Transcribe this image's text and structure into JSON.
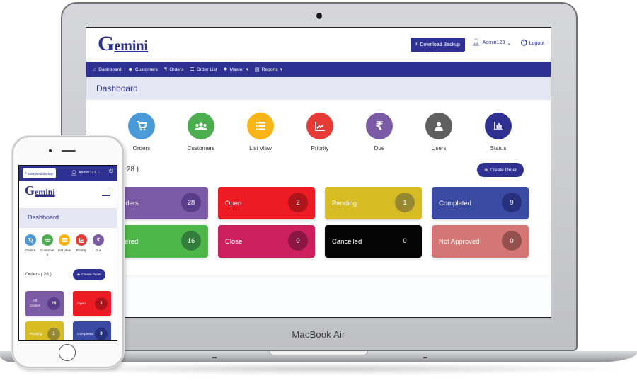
{
  "device": {
    "laptop_label": "MacBook Air"
  },
  "app": {
    "logo_initial": "G",
    "logo_rest": "emini",
    "download_backup_label": "Download Backup",
    "username": "Admin123",
    "logout_label": "Logout",
    "brand_color": "#2e3192"
  },
  "nav": {
    "items": [
      {
        "label": "Dashboard",
        "icon": "dashboard-icon",
        "glyph": "⌂",
        "dropdown": false
      },
      {
        "label": "Customers",
        "icon": "customers-icon",
        "glyph": "☻",
        "dropdown": false
      },
      {
        "label": "Orders",
        "icon": "rupee-icon",
        "glyph": "₹",
        "dropdown": false
      },
      {
        "label": "Order List",
        "icon": "list-icon",
        "glyph": "☰",
        "dropdown": false
      },
      {
        "label": "Master",
        "icon": "gear-icon",
        "glyph": "✹",
        "dropdown": true
      },
      {
        "label": "Reports",
        "icon": "document-icon",
        "glyph": "▤",
        "dropdown": true
      }
    ]
  },
  "page": {
    "title": "Dashboard",
    "orders_heading": "Orders ( 28 )",
    "orders_heading_laptop_visible": "ers ( 28 )",
    "create_order_label": "Create Order"
  },
  "quick_links": [
    {
      "label": "Orders",
      "icon": "cart-icon",
      "glyph": "🛒",
      "color": "#4a9ad8"
    },
    {
      "label": "Customers",
      "icon": "customers-icon",
      "glyph": "👥",
      "color": "#4cae4f"
    },
    {
      "label": "List View",
      "icon": "list-icon",
      "glyph": "☰",
      "color": "#fbb416"
    },
    {
      "label": "Priority",
      "icon": "chart-icon",
      "glyph": "📈",
      "color": "#e53a35"
    },
    {
      "label": "Due",
      "icon": "rupee-icon",
      "glyph": "₹",
      "color": "#7b5aa6"
    },
    {
      "label": "Users",
      "icon": "user-icon",
      "glyph": "👤",
      "color": "#5f5f5f"
    },
    {
      "label": "Status",
      "icon": "bar-chart-icon",
      "glyph": "▥",
      "color": "#2e3192"
    }
  ],
  "status_tiles": [
    {
      "label": "All Orders",
      "visible_label": "l Orders",
      "count": "28",
      "color": "#7b5aa6",
      "badge": "#5a3d8a"
    },
    {
      "label": "Open",
      "visible_label": "Open",
      "count": "2",
      "color": "#ed1c24",
      "badge": "#b0141b"
    },
    {
      "label": "Pending",
      "visible_label": "Pending",
      "count": "1",
      "color": "#d7bd23",
      "badge": "#958830"
    },
    {
      "label": "Completed",
      "visible_label": "Completed",
      "count": "9",
      "color": "#3b4aa3",
      "badge": "#27307c"
    },
    {
      "label": "Delivered",
      "visible_label": "elivered",
      "count": "16",
      "color": "#4db848",
      "badge": "#337d3a"
    },
    {
      "label": "Close",
      "visible_label": "Close",
      "count": "0",
      "color": "#cc1f5e",
      "badge": "#8c1643"
    },
    {
      "label": "Cancelled",
      "visible_label": "Cancelled",
      "count": "0",
      "color": "#050505",
      "badge": "#050505"
    },
    {
      "label": "Not Approved",
      "visible_label": "Not Approved",
      "count": "0",
      "color": "#d37674",
      "badge": "#94504f"
    }
  ],
  "phone": {
    "quick_labels": [
      "Orders",
      "Customers",
      "List View",
      "Priority",
      "Due"
    ],
    "tiles": [
      {
        "label_line1": "All",
        "label_line2": "Orders",
        "count": "28"
      },
      {
        "label_line1": "Open",
        "label_line2": "",
        "count": "2"
      },
      {
        "label_line1": "Pending",
        "label_line2": "",
        "count": "1"
      },
      {
        "label_line1": "Completed",
        "label_line2": "",
        "count": "9"
      }
    ]
  }
}
